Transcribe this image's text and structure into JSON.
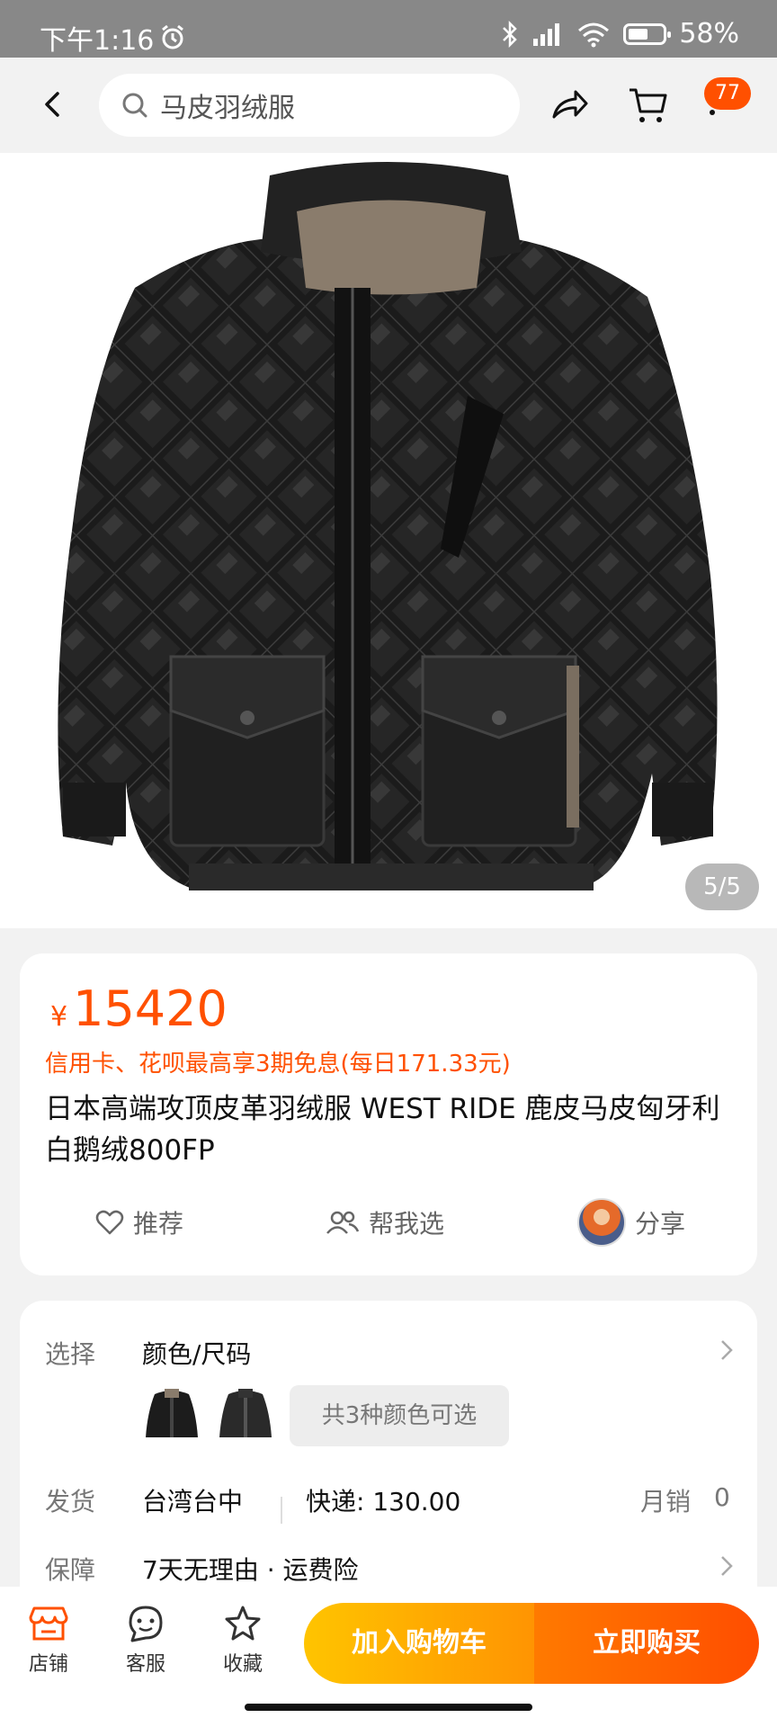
{
  "status_bar": {
    "time": "下午1:16",
    "battery": "58%",
    "battery_level": 0.58
  },
  "search": {
    "query": "马皮羽绒服"
  },
  "cart_badge": "77",
  "gallery": {
    "counter": "5/5"
  },
  "price": {
    "symbol": "¥",
    "amount": "15420"
  },
  "installment": "信用卡、花呗最高享3期免息(每日171.33元)",
  "product_title": "日本高端攻顶皮革羽绒服 WEST RIDE 鹿皮马皮匈牙利白鹅绒800FP",
  "actions": {
    "recommend": "推荐",
    "help_choose": "帮我选",
    "share": "分享"
  },
  "options": {
    "select_label": "选择",
    "select_value": "颜色/尺码",
    "colors_chip": "共3种颜色可选",
    "ship_label": "发货",
    "ship_from": "台湾台中",
    "express": "快递: 130.00",
    "monthly_sales_label": "月销",
    "monthly_sales": "0",
    "guarantee_label": "保障",
    "guarantee_value": "7天无理由 · 运费险"
  },
  "bottom_bar": {
    "store": "店铺",
    "service": "客服",
    "favorite": "收藏",
    "add_to_cart": "加入购物车",
    "buy_now": "立即购买"
  },
  "colors": {
    "accent": "#ff5000",
    "cart_btn": "#ffb300",
    "buy_btn": "#ff5a00"
  }
}
